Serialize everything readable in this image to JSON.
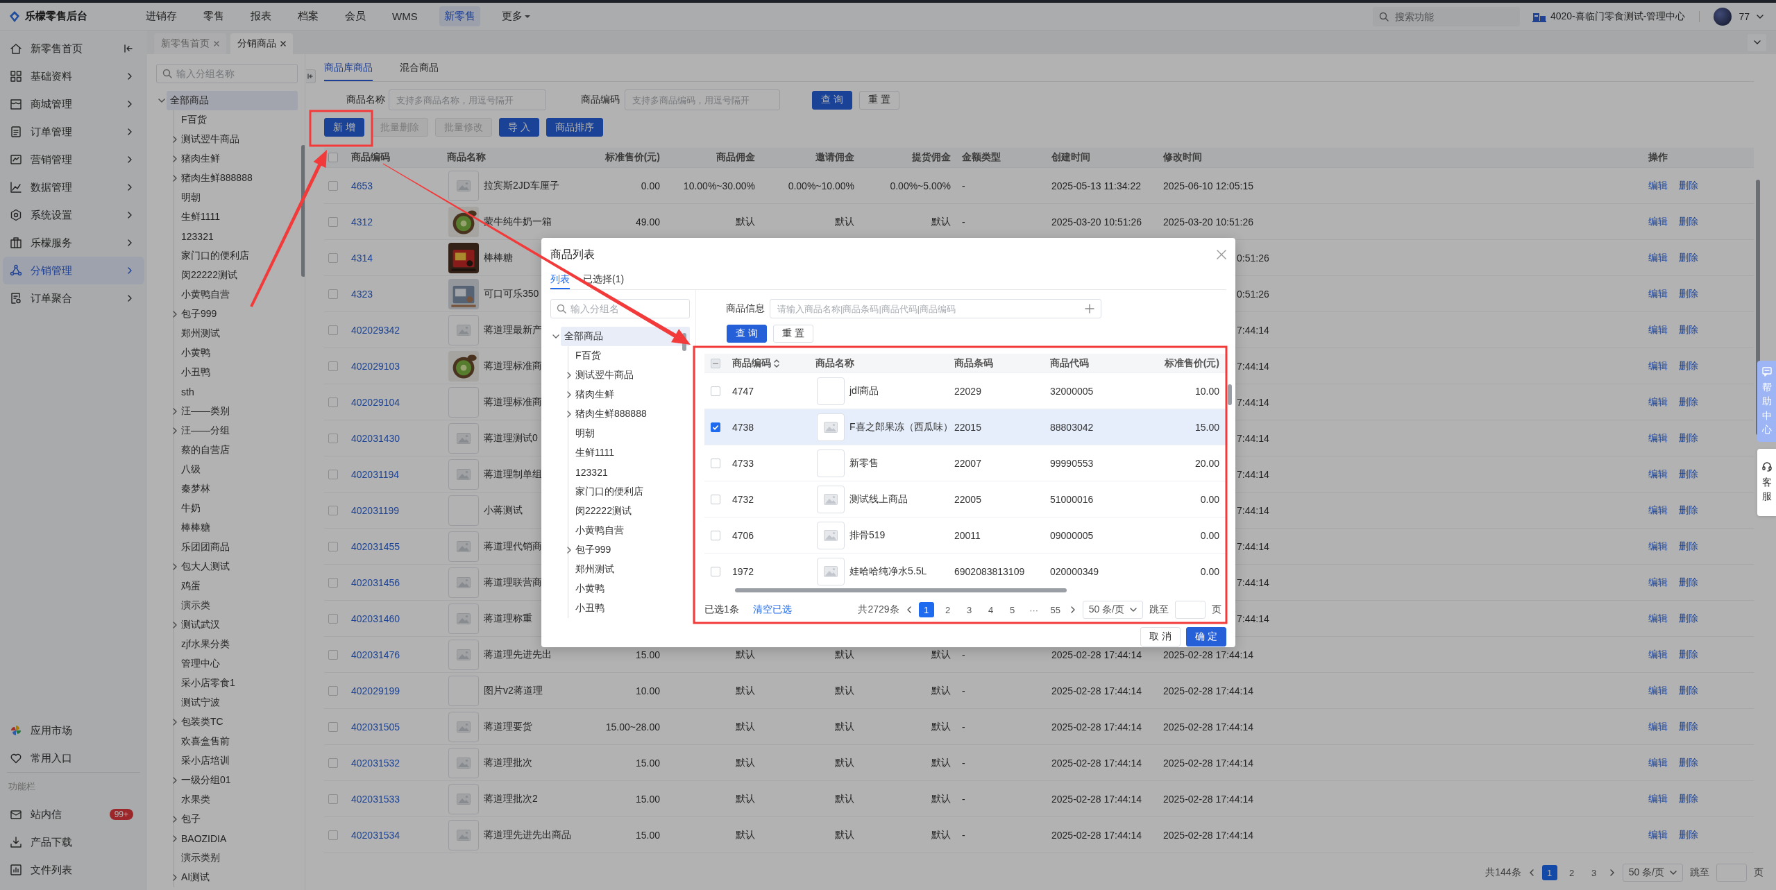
{
  "header": {
    "logo": "乐檬零售后台",
    "nav": [
      {
        "label": "进销存",
        "selected": false
      },
      {
        "label": "零售",
        "selected": false
      },
      {
        "label": "报表",
        "selected": false
      },
      {
        "label": "档案",
        "selected": false
      },
      {
        "label": "会员",
        "selected": false
      },
      {
        "label": "WMS",
        "selected": false
      },
      {
        "label": "新零售",
        "selected": true
      }
    ],
    "more": "更多",
    "search": {
      "placeholder": "搜索功能"
    },
    "store": "4020-喜临门零食测试-管理中心",
    "user": "77"
  },
  "sidebar": {
    "items": [
      {
        "label": "新零售首页",
        "selected": false
      },
      {
        "label": "基础资料",
        "selected": false
      },
      {
        "label": "商城管理",
        "selected": false
      },
      {
        "label": "订单管理",
        "selected": false
      },
      {
        "label": "营销管理",
        "selected": false
      },
      {
        "label": "数据管理",
        "selected": false
      },
      {
        "label": "系统设置",
        "selected": false
      },
      {
        "label": "乐檬服务",
        "selected": false
      },
      {
        "label": "分销管理",
        "selected": true
      },
      {
        "label": "订单聚合",
        "selected": false
      }
    ],
    "shortcuts": [
      {
        "label": "应用市场"
      },
      {
        "label": "常用入口"
      }
    ],
    "tools_title": "功能栏",
    "tools": [
      {
        "label": "站内信",
        "badge": "99+"
      },
      {
        "label": "产品下载"
      },
      {
        "label": "文件列表"
      }
    ]
  },
  "tabs": [
    {
      "label": "新零售首页",
      "selected": false
    },
    {
      "label": "分销商品",
      "selected": true
    }
  ],
  "group_panel": {
    "search": {
      "placeholder": "输入分组名称"
    },
    "tree": [
      {
        "label": "全部商品",
        "selected": true,
        "expanded": true,
        "children": [
          {
            "label": "F百货",
            "kind": "leaf",
            "selected": false
          },
          {
            "label": "测试翌牛商品",
            "kind": "group",
            "selected": false
          },
          {
            "label": "猪肉生鲜",
            "kind": "group",
            "selected": false
          },
          {
            "label": "猪肉生鲜888888",
            "kind": "group",
            "selected": false
          },
          {
            "label": "明朝",
            "kind": "leaf",
            "selected": false
          },
          {
            "label": "生鲜1111",
            "kind": "leaf",
            "selected": false
          },
          {
            "label": "123321",
            "kind": "leaf",
            "selected": false
          },
          {
            "label": "家门口的便利店",
            "kind": "leaf",
            "selected": false
          },
          {
            "label": "闵22222测试",
            "kind": "leaf",
            "selected": false
          },
          {
            "label": "小黄鸭自营",
            "kind": "leaf",
            "selected": false
          },
          {
            "label": "包子999",
            "kind": "group",
            "selected": false
          },
          {
            "label": "郑州测试",
            "kind": "leaf",
            "selected": false
          },
          {
            "label": "小黄鸭",
            "kind": "leaf",
            "selected": false
          },
          {
            "label": "小丑鸭",
            "kind": "leaf",
            "selected": false
          },
          {
            "label": "sth",
            "kind": "leaf",
            "selected": false
          },
          {
            "label": "汪——类别",
            "kind": "group",
            "selected": false
          },
          {
            "label": "汪——分组",
            "kind": "group",
            "selected": false
          },
          {
            "label": "蔡的自营店",
            "kind": "leaf",
            "selected": false
          },
          {
            "label": "八级",
            "kind": "leaf",
            "selected": false
          },
          {
            "label": "秦梦林",
            "kind": "leaf",
            "selected": false
          },
          {
            "label": "牛奶",
            "kind": "leaf",
            "selected": false
          },
          {
            "label": "棒棒糖",
            "kind": "leaf",
            "selected": false
          },
          {
            "label": "乐团团商品",
            "kind": "leaf",
            "selected": false
          },
          {
            "label": "包大人测试",
            "kind": "group",
            "selected": false
          },
          {
            "label": "鸡蛋",
            "kind": "leaf",
            "selected": false
          },
          {
            "label": "演示类",
            "kind": "leaf",
            "selected": false
          },
          {
            "label": "测试武汉",
            "kind": "group",
            "selected": false
          },
          {
            "label": "zjf水果分类",
            "kind": "leaf",
            "selected": false
          },
          {
            "label": "管理中心",
            "kind": "leaf",
            "selected": false
          },
          {
            "label": "采小店零食1",
            "kind": "leaf",
            "selected": false
          },
          {
            "label": "测试宁波",
            "kind": "leaf",
            "selected": false
          },
          {
            "label": "包装类TC",
            "kind": "group",
            "selected": false
          },
          {
            "label": "欢喜盒售前",
            "kind": "leaf",
            "selected": false
          },
          {
            "label": "采小店培训",
            "kind": "leaf",
            "selected": false
          },
          {
            "label": "一级分组01",
            "kind": "group",
            "selected": false
          },
          {
            "label": "水果类",
            "kind": "leaf",
            "selected": false
          },
          {
            "label": "包子",
            "kind": "group",
            "selected": false
          },
          {
            "label": "BAOZIDIA",
            "kind": "group",
            "selected": false
          },
          {
            "label": "演示类别",
            "kind": "leaf",
            "selected": false
          },
          {
            "label": "AI测试",
            "kind": "group",
            "selected": false
          }
        ]
      }
    ]
  },
  "content": {
    "tabs": [
      {
        "label": "商品库商品",
        "selected": true
      },
      {
        "label": "混合商品",
        "selected": false
      }
    ],
    "filters": [
      {
        "label": "商品名称",
        "placeholder": "支持多商品名称，用逗号隔开"
      },
      {
        "label": "商品编码",
        "placeholder": "支持多商品编码，用逗号隔开"
      }
    ],
    "filter_buttons": [
      {
        "label": "查 询",
        "kind": "primary"
      },
      {
        "label": "重 置",
        "kind": "default"
      }
    ],
    "actions": [
      {
        "label": "新 增",
        "kind": "primary",
        "disabled": false
      },
      {
        "label": "批量删除",
        "kind": "default",
        "disabled": true
      },
      {
        "label": "批量修改",
        "kind": "default",
        "disabled": true
      },
      {
        "label": "导 入",
        "kind": "primary",
        "disabled": false
      },
      {
        "label": "商品排序",
        "kind": "primary",
        "disabled": false
      }
    ],
    "table": {
      "header_checked": false,
      "columns": [
        "商品编码",
        "商品名称",
        "标准售价(元)",
        "商品佣金",
        "邀请佣金",
        "提货佣金",
        "金额类型",
        "创建时间",
        "修改时间",
        "操作"
      ],
      "rows": [
        {
          "checked": false,
          "code": "4653",
          "kind": "placeholder",
          "name": "拉宾斯2JD车厘子",
          "price": "0.00",
          "commission": "10.00%~30.00%",
          "invite": "0.00%~10.00%",
          "pickup": "0.00%~5.00%",
          "amount_type": "-",
          "created": "2025-05-13 11:34:22",
          "modified": "2025-06-10 12:05:15",
          "actions": [
            "编辑",
            "删除"
          ]
        },
        {
          "checked": false,
          "code": "4312",
          "name": "蒙牛纯牛奶一箱",
          "price": "49.00",
          "commission": "默认",
          "invite": "默认",
          "pickup": "默认",
          "amount_type": "-",
          "created": "2025-03-20 10:51:26",
          "modified": "2025-03-20 10:51:26",
          "actions": [
            "编辑",
            "删除"
          ]
        },
        {
          "checked": false,
          "code": "4314",
          "name": "棒棒糖",
          "modified_tail": "0:51:26",
          "actions": [
            "编辑",
            "删除"
          ]
        },
        {
          "checked": false,
          "code": "4323",
          "name": "可口可乐350",
          "modified_tail": "0:51:26",
          "actions": [
            "编辑",
            "删除"
          ]
        },
        {
          "checked": false,
          "code": "402029342",
          "kind": "placeholder",
          "name": "蒋道理最新产",
          "modified_tail": "7:44:14",
          "actions": [
            "编辑",
            "删除"
          ]
        },
        {
          "checked": false,
          "code": "402029103",
          "name": "蒋道理标准商",
          "modified_tail": "7:44:14",
          "actions": [
            "编辑",
            "删除"
          ]
        },
        {
          "checked": false,
          "code": "402029104",
          "kind": "blank",
          "name": "蒋道理标准商",
          "modified_tail": "7:44:14",
          "actions": [
            "编辑",
            "删除"
          ]
        },
        {
          "checked": false,
          "code": "402031430",
          "kind": "placeholder",
          "name": "蒋道理测试0",
          "modified_tail": "7:44:14",
          "actions": [
            "编辑",
            "删除"
          ]
        },
        {
          "checked": false,
          "code": "402031194",
          "kind": "placeholder",
          "name": "蒋道理制单组",
          "modified_tail": "7:44:14",
          "actions": [
            "编辑",
            "删除"
          ]
        },
        {
          "checked": false,
          "code": "402031199",
          "kind": "blank",
          "name": "小蒋测试",
          "modified_tail": "7:44:14",
          "actions": [
            "编辑",
            "删除"
          ]
        },
        {
          "checked": false,
          "code": "402031455",
          "kind": "placeholder",
          "name": "蒋道理代销商",
          "modified_tail": "7:44:14",
          "actions": [
            "编辑",
            "删除"
          ]
        },
        {
          "checked": false,
          "code": "402031456",
          "kind": "placeholder",
          "name": "蒋道理联营商",
          "modified_tail": "7:44:14",
          "actions": [
            "编辑",
            "删除"
          ]
        },
        {
          "checked": false,
          "code": "402031460",
          "kind": "placeholder",
          "name": "蒋道理称重",
          "modified_tail": "7:44:14",
          "actions": [
            "编辑",
            "删除"
          ]
        },
        {
          "checked": false,
          "code": "402031476",
          "kind": "placeholder",
          "name": "蒋道理先进先出",
          "price": "15.00",
          "commission": "默认",
          "invite": "默认",
          "pickup": "默认",
          "amount_type": "-",
          "created": "2025-02-28 17:44:14",
          "modified": "2025-02-28 17:44:14",
          "actions": [
            "编辑",
            "删除"
          ]
        },
        {
          "checked": false,
          "code": "402029199",
          "kind": "blank",
          "name": "图片v2蒋道理",
          "price": "10.00",
          "commission": "默认",
          "invite": "默认",
          "pickup": "默认",
          "amount_type": "-",
          "created": "2025-02-28 17:44:14",
          "modified": "2025-02-28 17:44:14",
          "actions": [
            "编辑",
            "删除"
          ]
        },
        {
          "checked": false,
          "code": "402031505",
          "kind": "placeholder",
          "name": "蒋道理要货",
          "price": "15.00~28.00",
          "commission": "默认",
          "invite": "默认",
          "pickup": "默认",
          "amount_type": "-",
          "created": "2025-02-28 17:44:14",
          "modified": "2025-02-28 17:44:14",
          "actions": [
            "编辑",
            "删除"
          ]
        },
        {
          "checked": false,
          "code": "402031532",
          "kind": "placeholder",
          "name": "蒋道理批次",
          "price": "15.00",
          "commission": "默认",
          "invite": "默认",
          "pickup": "默认",
          "amount_type": "-",
          "created": "2025-02-28 17:44:14",
          "modified": "2025-02-28 17:44:14",
          "actions": [
            "编辑",
            "删除"
          ]
        },
        {
          "checked": false,
          "code": "402031533",
          "kind": "placeholder",
          "name": "蒋道理批次2",
          "price": "15.00",
          "commission": "默认",
          "invite": "默认",
          "pickup": "默认",
          "amount_type": "-",
          "created": "2025-02-28 17:44:14",
          "modified": "2025-02-28 17:44:14",
          "actions": [
            "编辑",
            "删除"
          ]
        },
        {
          "checked": false,
          "code": "402031534",
          "kind": "placeholder",
          "name": "蒋道理先进先出商品",
          "price": "15.00",
          "commission": "默认",
          "invite": "默认",
          "pickup": "默认",
          "amount_type": "-",
          "created": "2025-02-28 17:44:14",
          "modified": "2025-02-28 17:44:14",
          "actions": [
            "编辑",
            "删除"
          ]
        }
      ]
    },
    "pagination": {
      "total": "共144条",
      "pages": [
        {
          "label": "1",
          "selected": true
        },
        {
          "label": "2",
          "selected": false
        },
        {
          "label": "3",
          "selected": false
        }
      ],
      "page_size": "50 条/页",
      "jump": "跳至",
      "unit": "页"
    }
  },
  "modal": {
    "title": "商品列表",
    "tabs": [
      {
        "label": "列表",
        "selected": true
      },
      {
        "label": "已选择(1)",
        "selected": false
      }
    ],
    "group_search": {
      "placeholder": "输入分组名"
    },
    "tree": [
      {
        "label": "全部商品",
        "selected": true,
        "expanded": true,
        "children": [
          {
            "label": "F百货",
            "kind": "leaf",
            "selected": false
          },
          {
            "label": "测试翌牛商品",
            "kind": "group",
            "selected": false
          },
          {
            "label": "猪肉生鲜",
            "kind": "group",
            "selected": false
          },
          {
            "label": "猪肉生鲜888888",
            "kind": "group",
            "selected": false
          },
          {
            "label": "明朝",
            "kind": "leaf",
            "selected": false
          },
          {
            "label": "生鲜1111",
            "kind": "leaf",
            "selected": false
          },
          {
            "label": "123321",
            "kind": "leaf",
            "selected": false
          },
          {
            "label": "家门口的便利店",
            "kind": "leaf",
            "selected": false
          },
          {
            "label": "闵22222测试",
            "kind": "leaf",
            "selected": false
          },
          {
            "label": "小黄鸭自营",
            "kind": "leaf",
            "selected": false
          },
          {
            "label": "包子999",
            "kind": "group",
            "selected": false
          },
          {
            "label": "郑州测试",
            "kind": "leaf",
            "selected": false
          },
          {
            "label": "小黄鸭",
            "kind": "leaf",
            "selected": false
          },
          {
            "label": "小丑鸭",
            "kind": "leaf",
            "selected": false
          }
        ]
      }
    ],
    "filter": {
      "label": "商品信息",
      "placeholder": "请输入商品名称|商品条码|商品代码|商品编码"
    },
    "buttons": [
      {
        "label": "查 询",
        "kind": "primary"
      },
      {
        "label": "重 置",
        "kind": "default"
      }
    ],
    "table": {
      "header_indeterminate": true,
      "columns": [
        "商品编码",
        "商品名称",
        "商品条码",
        "商品代码",
        "标准售价(元)"
      ],
      "rows": [
        {
          "selected": false,
          "checked": false,
          "code": "4747",
          "kind": "blank",
          "name": "jdl商品",
          "barcode": "22029",
          "item_code": "32000005",
          "price": "10.00"
        },
        {
          "selected": true,
          "checked": true,
          "code": "4738",
          "kind": "placeholder",
          "name": "F喜之郎果冻（西瓜味）",
          "barcode": "22015",
          "item_code": "88803042",
          "price": "15.00"
        },
        {
          "selected": false,
          "checked": false,
          "code": "4733",
          "kind": "blank",
          "name": "新零售",
          "barcode": "22007",
          "item_code": "99990553",
          "price": "20.00"
        },
        {
          "selected": false,
          "checked": false,
          "code": "4732",
          "kind": "placeholder",
          "name": "测试线上商品",
          "barcode": "22005",
          "item_code": "51000016",
          "price": "0.00"
        },
        {
          "selected": false,
          "checked": false,
          "code": "4706",
          "kind": "placeholder",
          "name": "排骨519",
          "barcode": "20011",
          "item_code": "09000005",
          "price": "0.00"
        },
        {
          "selected": false,
          "checked": false,
          "code": "1972",
          "kind": "placeholder",
          "name": "娃哈哈纯净水5.5L",
          "barcode": "6902083813109",
          "item_code": "020000349",
          "price": "0.00"
        }
      ]
    },
    "footer": {
      "selected_count": "已选1条",
      "clear": "清空已选",
      "total": "共2729条",
      "pages": [
        {
          "label": "1",
          "selected": true
        },
        {
          "label": "2",
          "selected": false
        },
        {
          "label": "3",
          "selected": false
        },
        {
          "label": "4",
          "selected": false
        },
        {
          "label": "5",
          "selected": false
        },
        {
          "label": "···",
          "selected": false
        },
        {
          "label": "55",
          "selected": false
        }
      ],
      "page_size": "50 条/页",
      "jump": "跳至",
      "unit": "页"
    },
    "footer_buttons": [
      {
        "label": "取 消",
        "kind": "default"
      },
      {
        "label": "确 定",
        "kind": "primary"
      }
    ]
  },
  "help": {
    "help_center": "帮助中心",
    "service": "客服"
  }
}
